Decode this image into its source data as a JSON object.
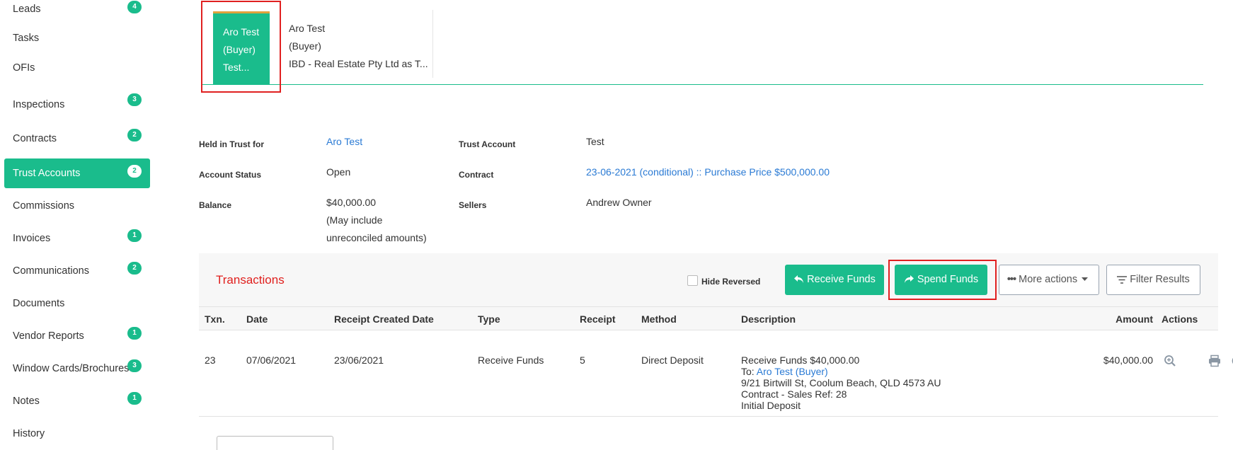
{
  "sidebar": {
    "items": [
      {
        "label": "Leads",
        "badge": "4"
      },
      {
        "label": "Tasks",
        "badge": ""
      },
      {
        "label": "OFIs",
        "badge": ""
      },
      {
        "label": "Inspections",
        "badge": "3"
      },
      {
        "label": "Contracts",
        "badge": "2"
      },
      {
        "label": "Trust Accounts",
        "badge": "2"
      },
      {
        "label": "Commissions",
        "badge": ""
      },
      {
        "label": "Invoices",
        "badge": "1"
      },
      {
        "label": "Communications",
        "badge": "2"
      },
      {
        "label": "Documents",
        "badge": ""
      },
      {
        "label": "Vendor Reports",
        "badge": "1"
      },
      {
        "label": "Window Cards/Brochures",
        "badge": "3"
      },
      {
        "label": "Notes",
        "badge": "1"
      },
      {
        "label": "History",
        "badge": ""
      }
    ]
  },
  "contact": {
    "tile_lines": [
      "Aro Test",
      "(Buyer)",
      "Test..."
    ],
    "info_lines": [
      "Aro Test",
      "(Buyer)",
      "IBD - Real Estate Pty Ltd as T..."
    ]
  },
  "details": {
    "held_in_trust_label": "Held in Trust for",
    "held_in_trust_value": "Aro Test",
    "account_status_label": "Account Status",
    "account_status_value": "Open",
    "balance_label": "Balance",
    "balance_value": "$40,000.00",
    "balance_note_1": "(May include",
    "balance_note_2": "unreconciled amounts)",
    "trust_account_label": "Trust Account",
    "trust_account_value": "Test",
    "contract_label": "Contract",
    "contract_value": "23-06-2021 (conditional) :: Purchase Price $500,000.00",
    "sellers_label": "Sellers",
    "sellers_value": "Andrew Owner"
  },
  "transactions": {
    "title": "Transactions",
    "hide_reversed_label": "Hide Reversed",
    "receive_funds_label": "Receive Funds",
    "spend_funds_label": "Spend Funds",
    "more_actions_label": "More actions",
    "filter_results_label": "Filter Results",
    "columns": [
      "Txn.",
      "Date",
      "Receipt Created Date",
      "Type",
      "Receipt",
      "Method",
      "Description",
      "Amount",
      "Actions"
    ],
    "rows": [
      {
        "txn": "23",
        "date": "07/06/2021",
        "receipt_created": "23/06/2021",
        "type": "Receive Funds",
        "receipt": "5",
        "method": "Direct Deposit",
        "desc_line1": "Receive Funds $40,000.00",
        "desc_to_prefix": "To: ",
        "desc_to_link": "Aro Test (Buyer)",
        "desc_line3": "9/21 Birtwill St, Coolum Beach, QLD 4573 AU",
        "desc_line4": "Contract - Sales Ref: 28",
        "desc_line5": "Initial Deposit",
        "amount": "$40,000.00"
      }
    ]
  },
  "colors": {
    "accent": "#1abc8c",
    "highlight": "#e02020",
    "link": "#2a7ad4",
    "title_red": "#e0201e"
  },
  "icons": [
    "zoom-in-icon",
    "print-icon",
    "email-icon",
    "reply-icon",
    "undo-arrow-icon",
    "share-arrow-icon",
    "ellipsis-icon",
    "caret-down-icon",
    "filter-icon"
  ]
}
